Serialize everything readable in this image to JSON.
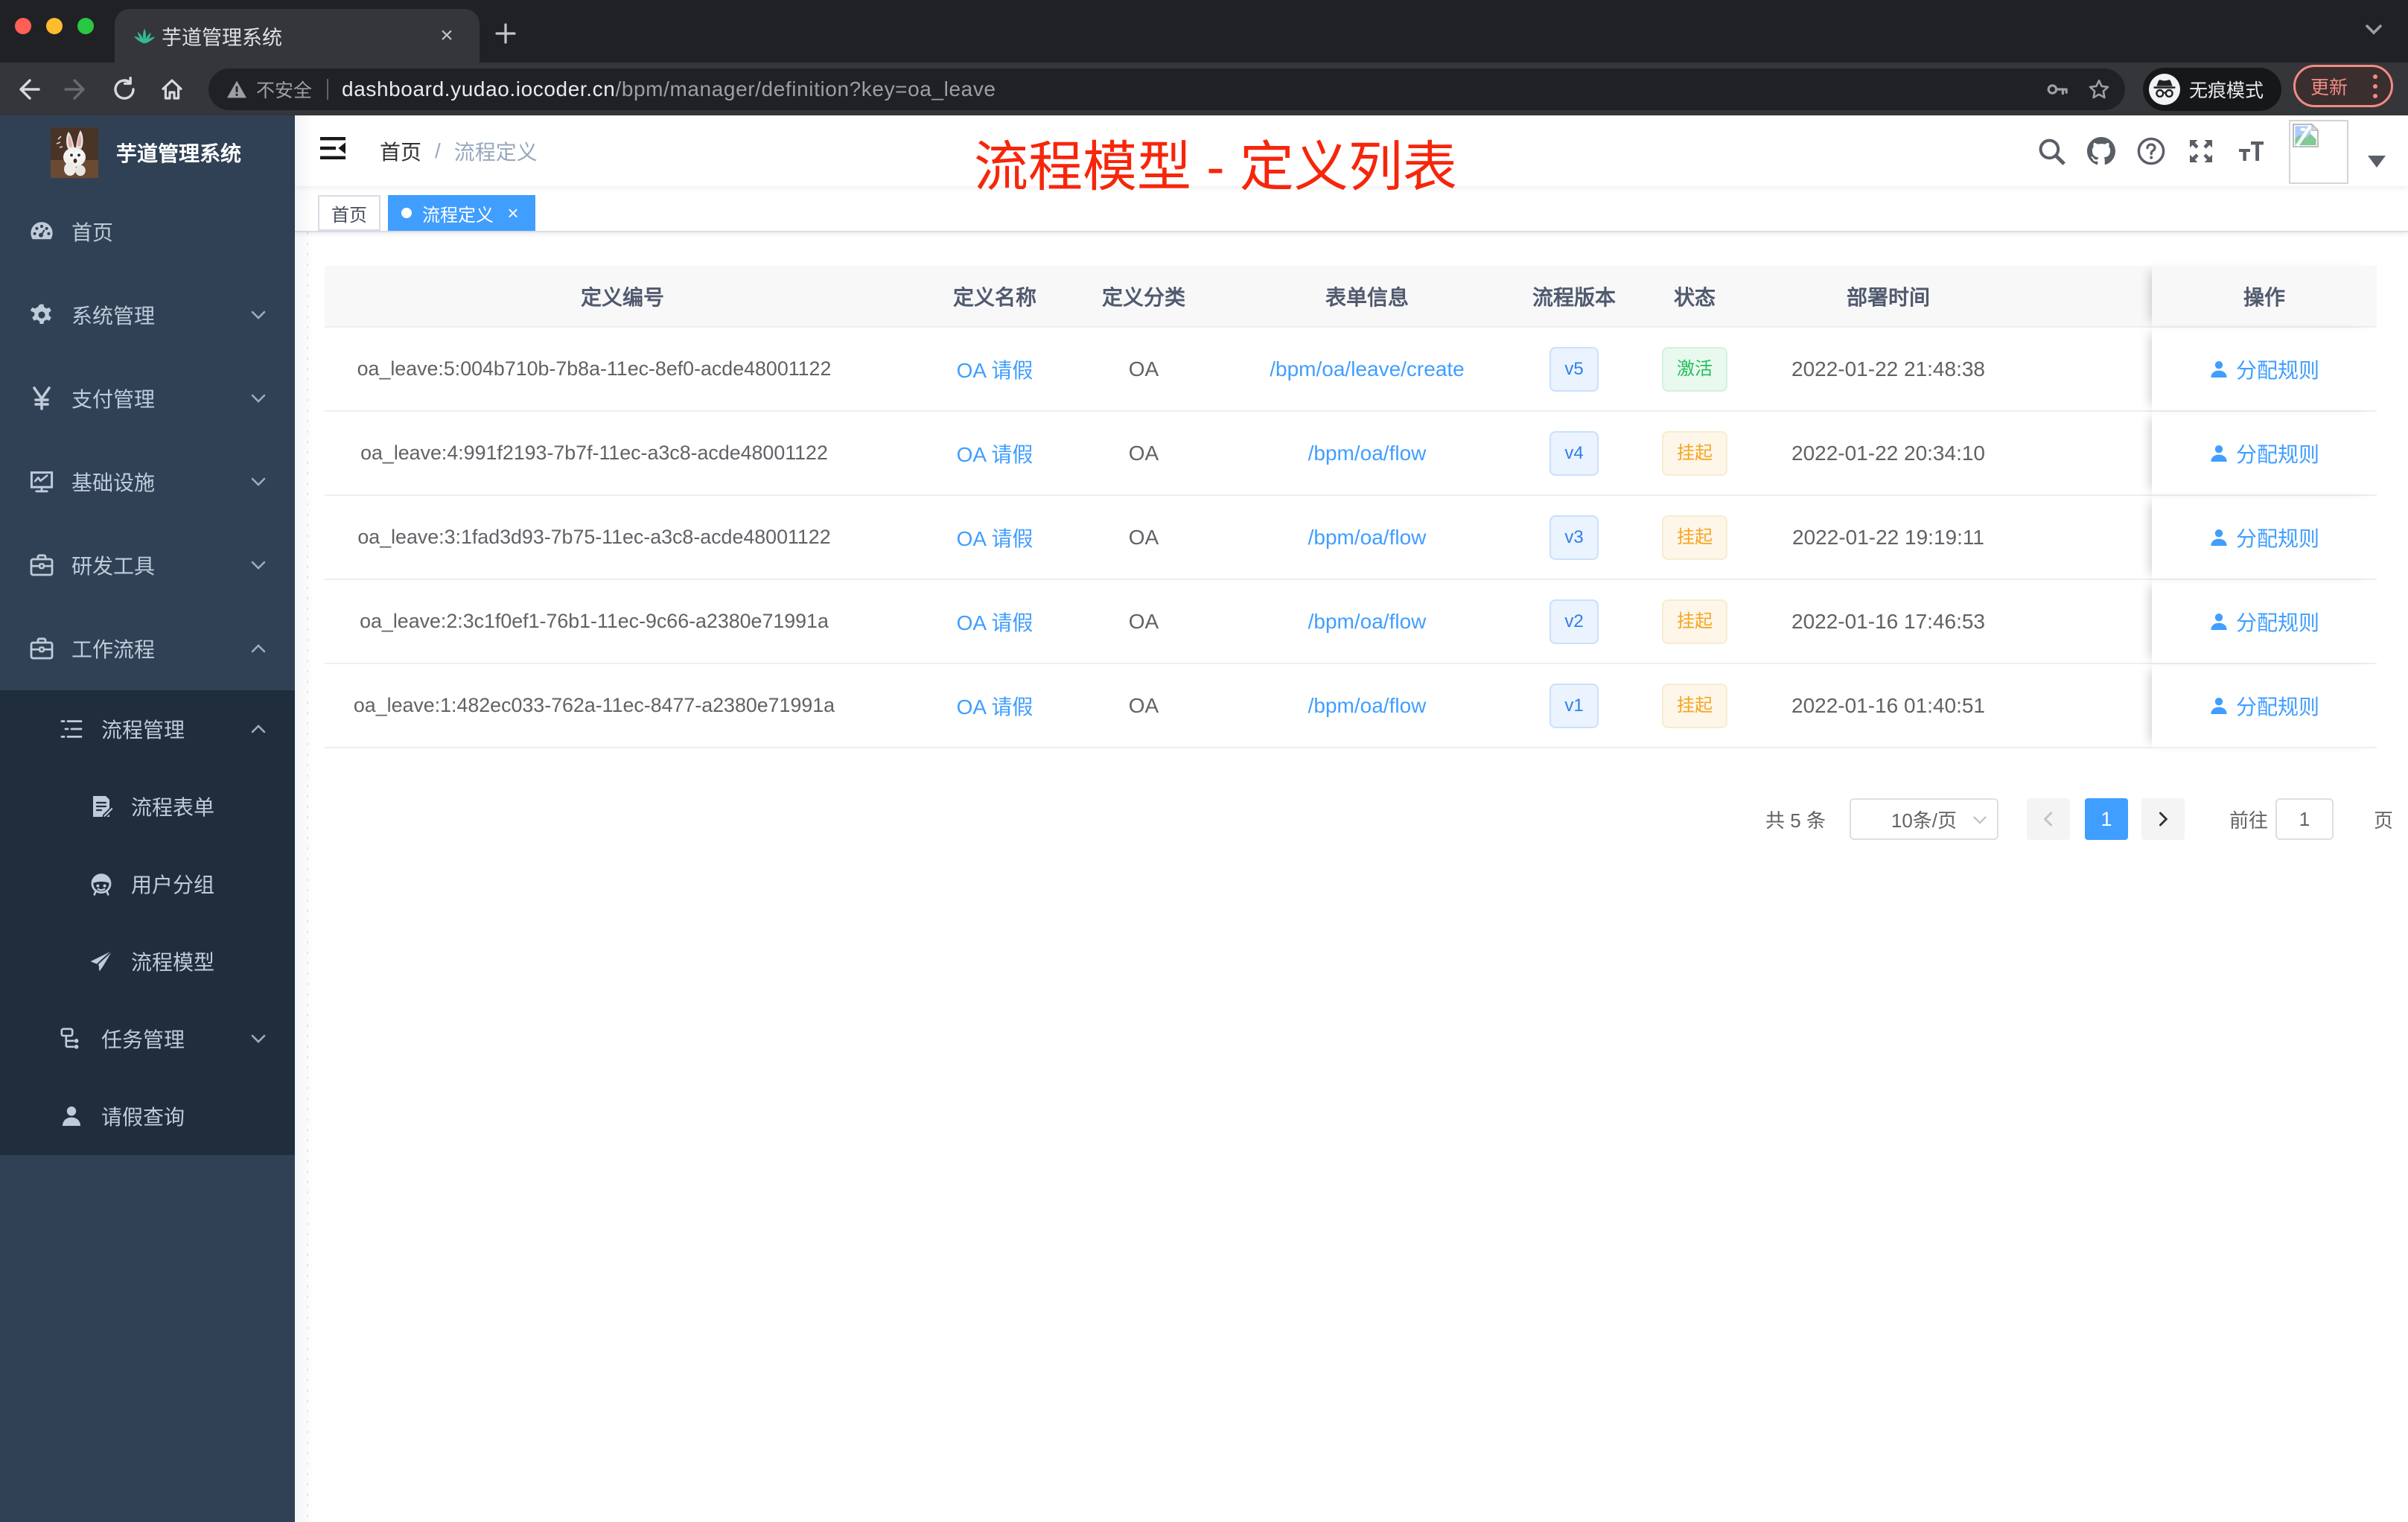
{
  "browser": {
    "tab_title": "芋道管理系统",
    "close_tab_label": "×",
    "security_label": "不安全",
    "url_host": "dashboard.yudao.iocoder.cn",
    "url_path": "/bpm/manager/definition?key=oa_leave",
    "incognito_label": "无痕模式",
    "update_label": "更新"
  },
  "sidebar": {
    "logo_title": "芋道管理系统",
    "menu": [
      {
        "label": "首页"
      },
      {
        "label": "系统管理"
      },
      {
        "label": "支付管理"
      },
      {
        "label": "基础设施"
      },
      {
        "label": "研发工具"
      },
      {
        "label": "工作流程"
      },
      {
        "label": "流程管理"
      },
      {
        "label": "流程表单"
      },
      {
        "label": "用户分组"
      },
      {
        "label": "流程模型"
      },
      {
        "label": "任务管理"
      },
      {
        "label": "请假查询"
      }
    ],
    "yen_symbol": "¥"
  },
  "header": {
    "breadcrumb_home": "首页",
    "breadcrumb_separator": "/",
    "breadcrumb_current": "流程定义",
    "annotation": "流程模型 - 定义列表"
  },
  "tags_view": [
    {
      "label": "首页"
    },
    {
      "label": "流程定义",
      "close": "×"
    }
  ],
  "table": {
    "columns": [
      "定义编号",
      "定义名称",
      "定义分类",
      "表单信息",
      "流程版本",
      "状态",
      "部署时间",
      "操作"
    ],
    "rows": [
      {
        "id": "oa_leave:5:004b710b-7b8a-11ec-8ef0-acde48001122",
        "name": "OA 请假",
        "category": "OA",
        "form": "/bpm/oa/leave/create",
        "version": "v5",
        "status": "激活",
        "deploy_time": "2022-01-22 21:48:38",
        "action": "分配规则"
      },
      {
        "id": "oa_leave:4:991f2193-7b7f-11ec-a3c8-acde48001122",
        "name": "OA 请假",
        "category": "OA",
        "form": "/bpm/oa/flow",
        "version": "v4",
        "status": "挂起",
        "deploy_time": "2022-01-22 20:34:10",
        "action": "分配规则"
      },
      {
        "id": "oa_leave:3:1fad3d93-7b75-11ec-a3c8-acde48001122",
        "name": "OA 请假",
        "category": "OA",
        "form": "/bpm/oa/flow",
        "version": "v3",
        "status": "挂起",
        "deploy_time": "2022-01-22 19:19:11",
        "action": "分配规则"
      },
      {
        "id": "oa_leave:2:3c1f0ef1-76b1-11ec-9c66-a2380e71991a",
        "name": "OA 请假",
        "category": "OA",
        "form": "/bpm/oa/flow",
        "version": "v2",
        "status": "挂起",
        "deploy_time": "2022-01-16 17:46:53",
        "action": "分配规则"
      },
      {
        "id": "oa_leave:1:482ec033-762a-11ec-8477-a2380e71991a",
        "name": "OA 请假",
        "category": "OA",
        "form": "/bpm/oa/flow",
        "version": "v1",
        "status": "挂起",
        "deploy_time": "2022-01-16 01:40:51",
        "action": "分配规则"
      }
    ]
  },
  "pagination": {
    "total_text": "共 5 条",
    "page_size": "10条/页",
    "current_page": "1",
    "jump_prefix": "前往",
    "jump_value": "1",
    "jump_suffix": "页"
  },
  "colors": {
    "accent": "#409eff",
    "success": "#21bf5b",
    "warning": "#f6a623",
    "annotation_red": "#f6260b",
    "sidebar_bg": "#304156",
    "submenu_bg": "#1f2d3d"
  }
}
